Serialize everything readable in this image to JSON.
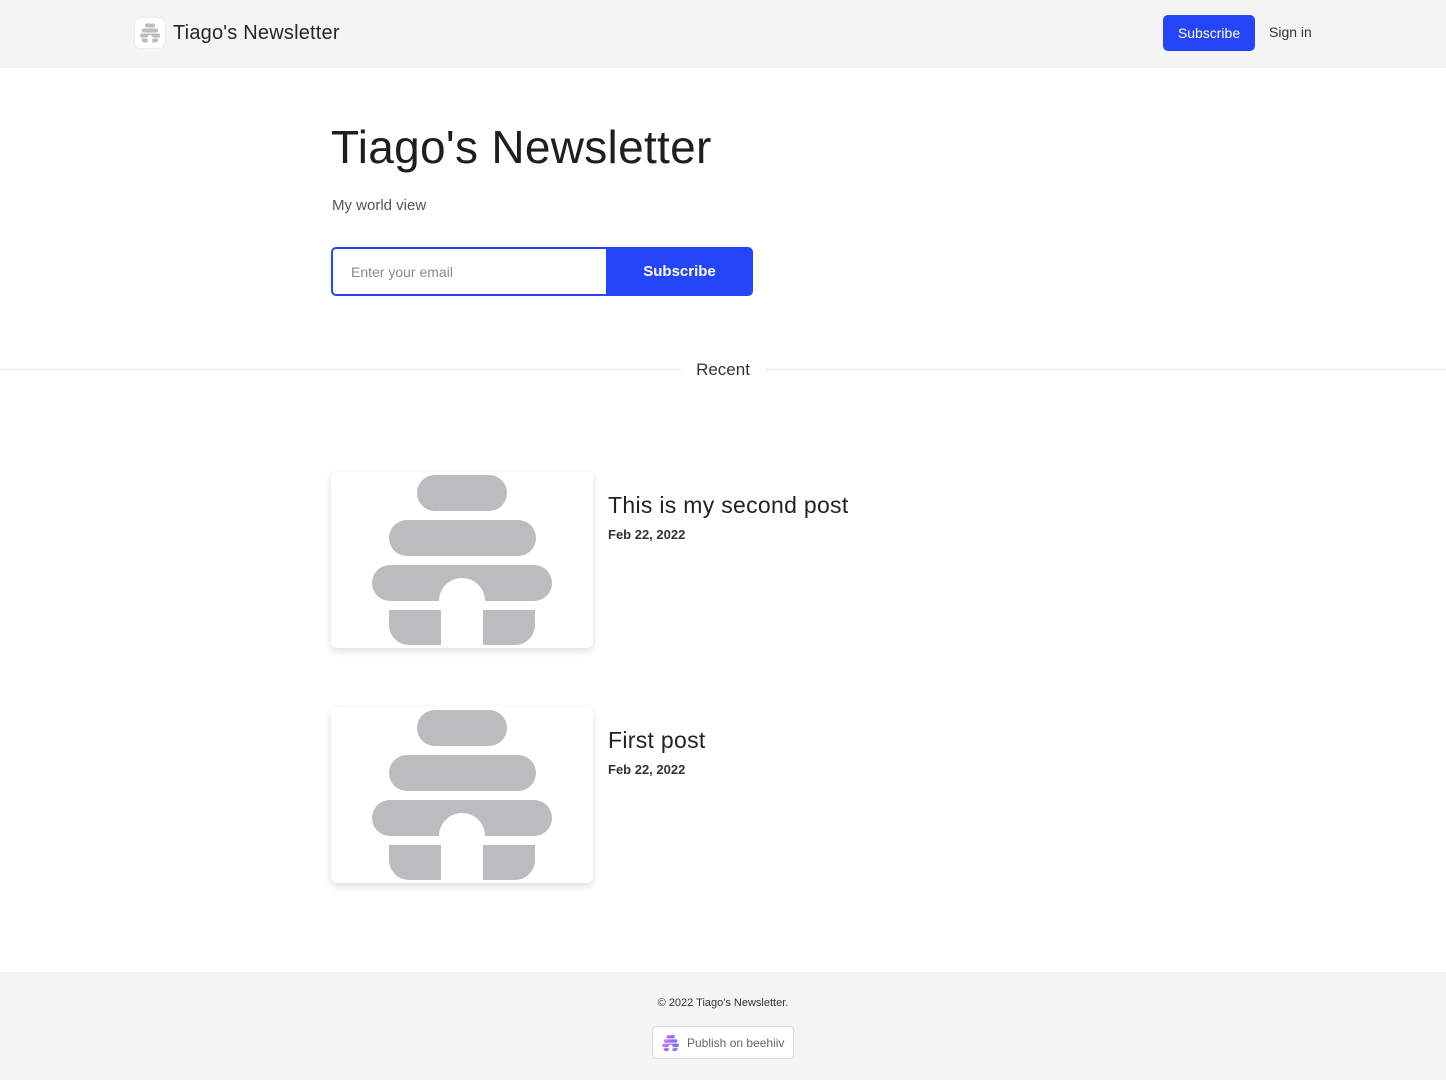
{
  "header": {
    "brand_name": "Tiago's Newsletter",
    "subscribe_label": "Subscribe",
    "signin_label": "Sign in"
  },
  "hero": {
    "title": "Tiago's Newsletter",
    "description": "My world view",
    "email_placeholder": "Enter your email",
    "email_value": "",
    "subscribe_label": "Subscribe"
  },
  "section": {
    "label": "Recent"
  },
  "posts": [
    {
      "title": "This is my second post",
      "date": "Feb 22, 2022",
      "thumbnail_icon": "beehive-placeholder-icon"
    },
    {
      "title": "First post",
      "date": "Feb 22, 2022",
      "thumbnail_icon": "beehive-placeholder-icon"
    }
  ],
  "footer": {
    "copyright": "© 2022 Tiago's Newsletter.",
    "badge_label": "Publish on beehiiv"
  },
  "colors": {
    "accent": "#2545f8",
    "header_bg": "#f4f4f5",
    "placeholder_gray": "#bcbcbe"
  }
}
